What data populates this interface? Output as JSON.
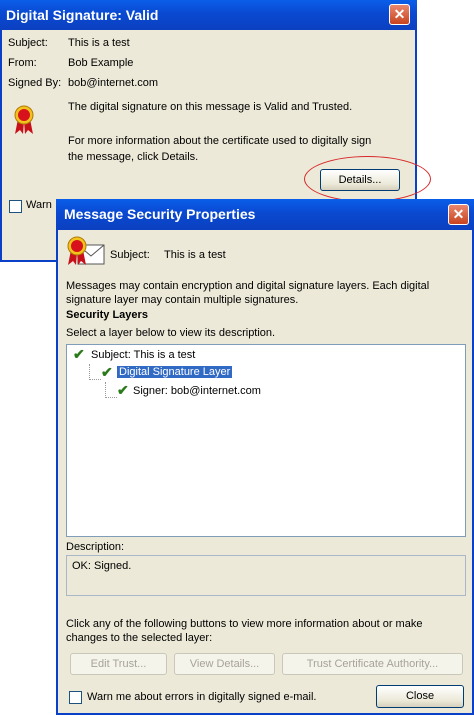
{
  "signature_dialog": {
    "title": "Digital Signature: Valid",
    "close_glyph": "✕",
    "subject_label": "Subject:",
    "subject_value": "This is a test",
    "from_label": "From:",
    "from_value": "Bob Example",
    "signed_by_label": "Signed By:",
    "signed_by_value": "bob@internet.com",
    "status_text": "The digital signature on this message is Valid and Trusted.",
    "info_line1": "For more information about the certificate used to digitally sign",
    "info_line2": "the message, click Details.",
    "details_button": "Details...",
    "warn_partial": "Warn"
  },
  "security_dialog": {
    "title": "Message Security Properties",
    "close_glyph": "✕",
    "subject_label": "Subject:",
    "subject_value": "This is a test",
    "intro_line1": "Messages may contain encryption and digital signature layers. Each digital",
    "intro_line2": "signature layer may contain multiple signatures.",
    "section_title": "Security Layers",
    "select_hint": "Select a layer below to view its description.",
    "tree": {
      "root": "Subject:  This is a test",
      "layer": "Digital Signature Layer",
      "signer": "Signer: bob@internet.com"
    },
    "description_label": "Description:",
    "description_value": "OK: Signed.",
    "buttons_hint_line1": "Click any of the following buttons to view more information about or make",
    "buttons_hint_line2": "changes to the selected layer:",
    "edit_trust_button": "Edit Trust...",
    "view_details_button": "View Details...",
    "trust_ca_button": "Trust Certificate Authority...",
    "warn_checkbox_label": "Warn me about errors in digitally signed e-mail.",
    "close_button": "Close"
  },
  "colors": {
    "titlebar": "#0a49d1",
    "dialog_bg": "#ece9d8",
    "selection": "#316ac5",
    "check_green": "#2a7a1a",
    "highlight_ring": "#d8282a"
  },
  "icons": {
    "ribbon": "certificate-ribbon-icon",
    "envelope": "envelope-icon",
    "check": "check-icon",
    "close": "close-icon"
  }
}
